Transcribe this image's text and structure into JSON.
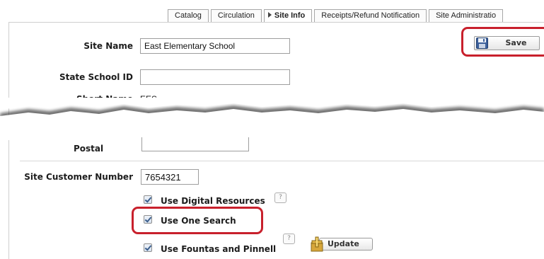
{
  "tabs": [
    {
      "label": "Catalog",
      "active": false
    },
    {
      "label": "Circulation",
      "active": false
    },
    {
      "label": "Site Info",
      "active": true
    },
    {
      "label": "Receipts/Refund Notification",
      "active": false
    },
    {
      "label": "Site Administratio",
      "active": false
    }
  ],
  "form": {
    "site_name_label": "Site Name",
    "site_name_value": "East Elementary School",
    "state_school_id_label": "State School ID",
    "state_school_id_value": "",
    "short_name_label": "Short Name",
    "short_name_value": "EES",
    "postal_label": "Postal",
    "postal_value": "",
    "site_customer_number_label": "Site Customer Number",
    "site_customer_number_value": "7654321"
  },
  "toolbar": {
    "save_label": "Save",
    "update_label": "Update"
  },
  "options": [
    {
      "label": "Use Digital Resources",
      "checked": true,
      "help": "?"
    },
    {
      "label": "Use One Search",
      "checked": true
    },
    {
      "label": "Use Fountas and Pinnell",
      "checked": true,
      "help": "?"
    }
  ],
  "colors": {
    "highlight": "#c8202c",
    "tab_border": "#a7a7a7",
    "checkbox_mark": "#3b5e8c"
  },
  "icons": {
    "save": "floppy-disk-icon",
    "update": "plus-update-icon",
    "help": "help-icon"
  }
}
